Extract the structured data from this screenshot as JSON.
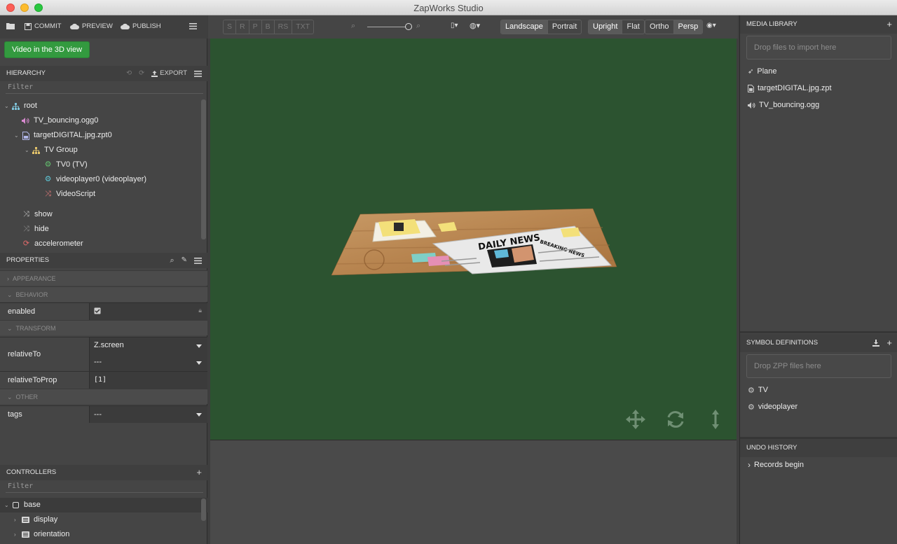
{
  "window": {
    "title": "ZapWorks Studio"
  },
  "toolbar": {
    "commit": "COMMIT",
    "preview": "PREVIEW",
    "publish": "PUBLISH",
    "video_button": "Video in the 3D view"
  },
  "hierarchy": {
    "title": "HIERARCHY",
    "export": "EXPORT",
    "filter": "Filter",
    "items": [
      {
        "label": "root"
      },
      {
        "label": "TV_bouncing.ogg0"
      },
      {
        "label": "targetDIGITAL.jpg.zpt0"
      },
      {
        "label": "TV Group"
      },
      {
        "label": "TV0 (TV)"
      },
      {
        "label": "videoplayer0 (videoplayer)"
      },
      {
        "label": "VideoScript"
      },
      {
        "label": "show"
      },
      {
        "label": "hide"
      },
      {
        "label": "accelerometer"
      }
    ]
  },
  "properties": {
    "title": "PROPERTIES",
    "sections": {
      "appearance": "APPEARANCE",
      "behavior": "BEHAVIOR",
      "transform": "TRANSFORM",
      "other": "OTHER"
    },
    "enabled_label": "enabled",
    "relativeTo_label": "relativeTo",
    "relativeTo_value1": "Z.screen",
    "relativeTo_value2": "---",
    "relativeToProp_label": "relativeToProp",
    "relativeToProp_value": "[1]",
    "tags_label": "tags",
    "tags_value": "---"
  },
  "controllers": {
    "title": "CONTROLLERS",
    "filter": "Filter",
    "items": [
      {
        "label": "base"
      },
      {
        "label": "display"
      },
      {
        "label": "orientation"
      }
    ]
  },
  "center": {
    "script_buttons": [
      "S",
      "R",
      "P",
      "B",
      "RS",
      "TXT"
    ],
    "orientation": [
      "Landscape",
      "Portrait"
    ],
    "mode": [
      "Upright",
      "Flat"
    ],
    "projection": [
      "Ortho",
      "Persp"
    ],
    "zoom_level": 1.0
  },
  "media": {
    "title": "MEDIA LIBRARY",
    "drop": "Drop files to import here",
    "items": [
      {
        "label": "Plane"
      },
      {
        "label": "targetDIGITAL.jpg.zpt"
      },
      {
        "label": "TV_bouncing.ogg"
      }
    ]
  },
  "symbols": {
    "title": "SYMBOL DEFINITIONS",
    "drop": "Drop ZPP files here",
    "items": [
      {
        "label": "TV"
      },
      {
        "label": "videoplayer"
      }
    ]
  },
  "undo": {
    "title": "UNDO HISTORY",
    "items": [
      {
        "label": "Records begin"
      }
    ]
  },
  "scene": {
    "newspaper_headline": "DAILY NEWS",
    "newspaper_subhead": "BREAKING NEWS"
  },
  "colors": {
    "viewport_bg": "#2c5330",
    "accent_green": "#339a3f"
  }
}
